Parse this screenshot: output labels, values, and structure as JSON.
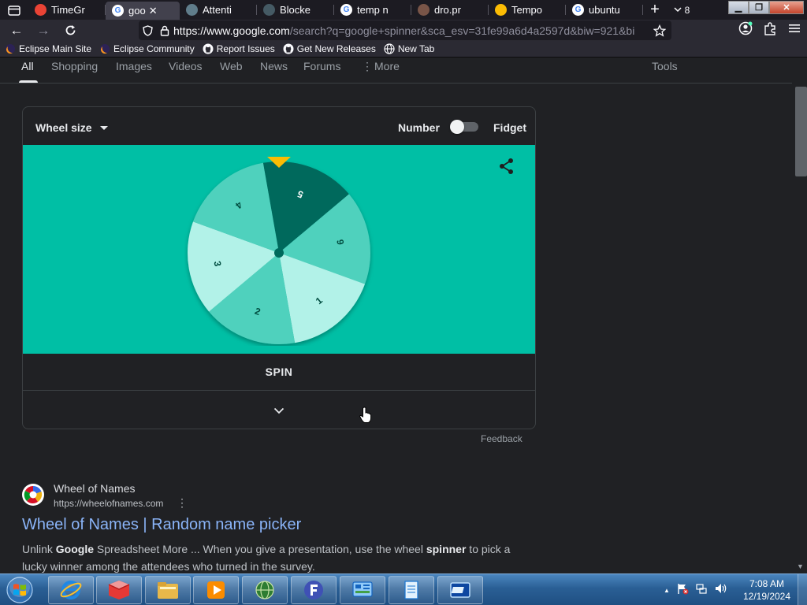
{
  "browser": {
    "tabs": [
      {
        "title": "TimeGr",
        "active": false
      },
      {
        "title": "goo",
        "active": true
      },
      {
        "title": "Attenti",
        "active": false
      },
      {
        "title": "Blocke",
        "active": false
      },
      {
        "title": "temp n",
        "active": false
      },
      {
        "title": "dro.pr",
        "active": false
      },
      {
        "title": "Tempo",
        "active": false
      },
      {
        "title": "ubuntu",
        "active": false
      }
    ],
    "tab_count": "8",
    "url_host": "https://www.google.com",
    "url_rest": "/search?q=google+spinner&sca_esv=31fe99a6d4a2597d&biw=921&bi",
    "bookmarks": [
      {
        "label": "Eclipse Main Site",
        "icon": "eclipse-icon"
      },
      {
        "label": "Eclipse Community",
        "icon": "eclipse-icon"
      },
      {
        "label": "Report Issues",
        "icon": "github-icon"
      },
      {
        "label": "Get New Releases",
        "icon": "github-icon"
      },
      {
        "label": "New Tab",
        "icon": "globe-icon"
      }
    ]
  },
  "search_tabs": [
    {
      "label": "All",
      "active": true
    },
    {
      "label": "Shopping"
    },
    {
      "label": "Images"
    },
    {
      "label": "Videos"
    },
    {
      "label": "Web"
    },
    {
      "label": "News"
    },
    {
      "label": "Forums"
    },
    {
      "label": "More"
    }
  ],
  "tools_label": "Tools",
  "spinner": {
    "wheel_size_label": "Wheel size",
    "number_label": "Number",
    "fidget_label": "Fidget",
    "toggle_on": false,
    "wheel_numbers": [
      "5",
      "6",
      "1",
      "2",
      "3",
      "4"
    ],
    "spin_label": "SPIN",
    "colors": {
      "background": "#00bfa5",
      "pointer": "#fbbc04",
      "dark_segment": "#00695c"
    }
  },
  "feedback_label": "Feedback",
  "result": {
    "site_name": "Wheel of Names",
    "url": "https://wheelofnames.com",
    "title": "Wheel of Names | Random name picker",
    "snippet_html_parts": [
      {
        "text": "Unlink ",
        "bold": false
      },
      {
        "text": "Google",
        "bold": true
      },
      {
        "text": " Spreadsheet More ... When you give a presentation, use the wheel ",
        "bold": false
      },
      {
        "text": "spinner",
        "bold": true
      },
      {
        "text": " to pick a lucky winner among the attendees who turned in the survey.",
        "bold": false
      }
    ]
  },
  "taskbar": {
    "time": "7:08 AM",
    "date": "12/19/2024"
  }
}
